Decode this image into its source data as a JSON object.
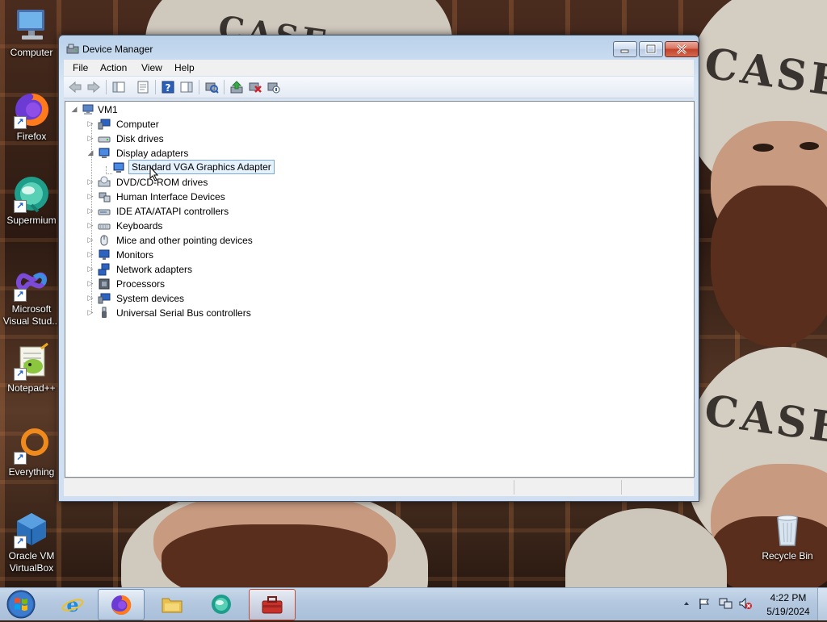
{
  "desktop": {
    "icons": [
      {
        "label": "Computer",
        "icon": "computer-icon"
      },
      {
        "label": "Firefox",
        "icon": "firefox-icon"
      },
      {
        "label": "Supermium",
        "icon": "supermium-icon"
      },
      {
        "label": "Microsoft Visual Stud...",
        "icon": "visual-studio-icon"
      },
      {
        "label": "Notepad++",
        "icon": "notepad-plus-plus-icon"
      },
      {
        "label": "Everything",
        "icon": "everything-icon"
      },
      {
        "label": "Oracle VM VirtualBox",
        "icon": "virtualbox-icon"
      },
      {
        "label": "Recycle Bin",
        "icon": "recycle-bin-icon"
      }
    ]
  },
  "window": {
    "title": "Device Manager",
    "menu": [
      "File",
      "Action",
      "View",
      "Help"
    ],
    "toolbar": [
      "back-icon",
      "forward-icon",
      "show-hide-console-tree-icon",
      "properties-icon",
      "help-icon",
      "action-pane-icon",
      "scan-hardware-changes-icon",
      "update-driver-icon",
      "uninstall-icon",
      "disable-device-icon"
    ],
    "tree": {
      "root": "VM1",
      "categories": [
        {
          "label": "Computer",
          "expanded": false,
          "icon": "computer-icon"
        },
        {
          "label": "Disk drives",
          "expanded": false,
          "icon": "disk-drive-icon"
        },
        {
          "label": "Display adapters",
          "expanded": true,
          "icon": "display-adapter-icon",
          "children": [
            {
              "label": "Standard VGA Graphics Adapter",
              "selected": true,
              "icon": "display-adapter-icon"
            }
          ]
        },
        {
          "label": "DVD/CD-ROM drives",
          "expanded": false,
          "icon": "dvd-drive-icon"
        },
        {
          "label": "Human Interface Devices",
          "expanded": false,
          "icon": "hid-icon"
        },
        {
          "label": "IDE ATA/ATAPI controllers",
          "expanded": false,
          "icon": "ide-controller-icon"
        },
        {
          "label": "Keyboards",
          "expanded": false,
          "icon": "keyboard-icon"
        },
        {
          "label": "Mice and other pointing devices",
          "expanded": false,
          "icon": "mouse-icon"
        },
        {
          "label": "Monitors",
          "expanded": false,
          "icon": "monitor-icon"
        },
        {
          "label": "Network adapters",
          "expanded": false,
          "icon": "network-adapter-icon"
        },
        {
          "label": "Processors",
          "expanded": false,
          "icon": "processor-icon"
        },
        {
          "label": "System devices",
          "expanded": false,
          "icon": "system-devices-icon"
        },
        {
          "label": "Universal Serial Bus controllers",
          "expanded": false,
          "icon": "usb-icon"
        }
      ]
    }
  },
  "taskbar": {
    "apps": [
      {
        "name": "internet-explorer-icon",
        "state": "pinned"
      },
      {
        "name": "firefox-icon",
        "state": "active"
      },
      {
        "name": "file-explorer-icon",
        "state": "pinned"
      },
      {
        "name": "supermium-icon",
        "state": "pinned"
      },
      {
        "name": "device-manager-icon",
        "state": "running"
      }
    ],
    "clock": {
      "time": "4:22 PM",
      "date": "5/19/2024"
    }
  }
}
